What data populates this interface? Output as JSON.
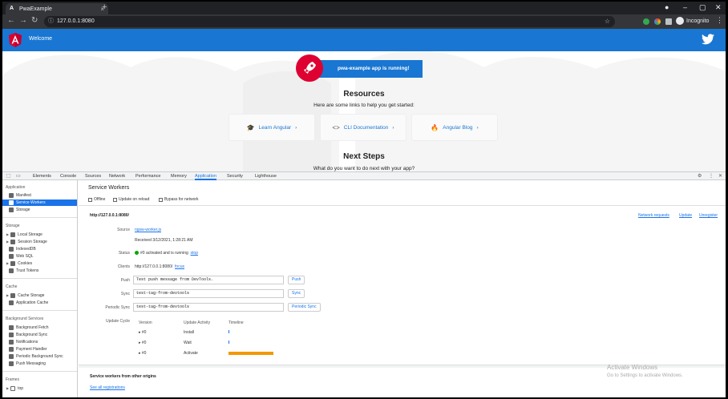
{
  "browser": {
    "tab_title": "PwaExample",
    "url": "127.0.0.1:8080",
    "profile": "Incognito",
    "tab_favicon": "A",
    "new_tab_label": "+",
    "tab_close": "×"
  },
  "app": {
    "header_title": "Welcome",
    "running_text": "pwa-example app is running!",
    "resources_title": "Resources",
    "resources_sub": "Here are some links to help you get started:",
    "cards": [
      {
        "label": "Learn Angular",
        "icon": "graduation-cap-icon"
      },
      {
        "label": "CLI Documentation",
        "icon": "code-icon"
      },
      {
        "label": "Angular Blog",
        "icon": "flame-icon"
      }
    ],
    "next_title": "Next Steps",
    "next_sub": "What do you want to do next with your app?",
    "accent_color": "#1976d2",
    "angular_red": "#dd0031"
  },
  "devtools": {
    "tabs": [
      "Elements",
      "Console",
      "Sources",
      "Network",
      "Performance",
      "Memory",
      "Application",
      "Security",
      "Lighthouse"
    ],
    "active_tab": "Application",
    "sidebar": {
      "application_head": "Application",
      "application_items": [
        "Manifest",
        "Service Workers",
        "Storage"
      ],
      "storage_head": "Storage",
      "storage_items": [
        "Local Storage",
        "Session Storage",
        "IndexedDB",
        "Web SQL",
        "Cookies",
        "Trust Tokens"
      ],
      "cache_head": "Cache",
      "cache_items": [
        "Cache Storage",
        "Application Cache"
      ],
      "bg_head": "Background Services",
      "bg_items": [
        "Background Fetch",
        "Background Sync",
        "Notifications",
        "Payment Handler",
        "Periodic Background Sync",
        "Push Messaging"
      ],
      "frames_head": "Frames",
      "frames_items": [
        "top"
      ]
    },
    "sw": {
      "title": "Service Workers",
      "options": [
        "Offline",
        "Update on reload",
        "Bypass for network"
      ],
      "origin": "http://127.0.0.1:8080/",
      "top_links": [
        "Network requests",
        "Update",
        "Unregister"
      ],
      "source_label": "Source",
      "source_file": "ngsw-worker.js",
      "received": "Received 3/12/2021, 1:28:21 AM",
      "status_label": "Status",
      "status_text": "#0 activated and is running",
      "status_link": "stop",
      "clients_label": "Clients",
      "clients_text": "http://127.0.0.1:8080/",
      "clients_link": "focus",
      "push_label": "Push",
      "push_value": "Test push message from DevTools.",
      "push_button": "Push",
      "sync_label": "Sync",
      "sync_value": "test-tag-from-devtools",
      "sync_button": "Sync",
      "periodic_label": "Periodic Sync",
      "periodic_value": "test-tag-from-devtools",
      "periodic_button": "Periodic Sync",
      "cycle_label": "Update Cycle",
      "cycle_headers": [
        "Version",
        "Update Activity",
        "Timeline"
      ],
      "cycle_rows": [
        {
          "version": "#0",
          "activity": "Install"
        },
        {
          "version": "#0",
          "activity": "Wait"
        },
        {
          "version": "#0",
          "activity": "Activate"
        }
      ],
      "other_title": "Service workers from other origins",
      "see_all": "See all registrations"
    }
  },
  "watermark": {
    "line1": "Activate Windows",
    "line2": "Go to Settings to activate Windows."
  }
}
